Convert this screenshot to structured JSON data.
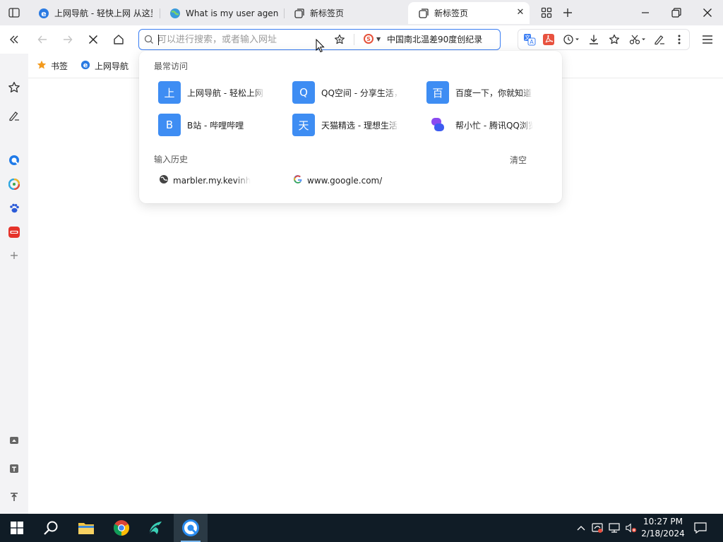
{
  "tabs": [
    {
      "title": "上网导航 - 轻快上网 从这里开始",
      "icon": "ie-e-icon",
      "active": false
    },
    {
      "title": "What is my user agent?",
      "icon": "globe-icon",
      "active": false
    },
    {
      "title": "新标签页",
      "icon": "tab-page-icon",
      "active": false
    },
    {
      "title": "新标签页",
      "icon": "tab-page-icon",
      "active": true
    }
  ],
  "address_bar": {
    "value": "",
    "placeholder": "可以进行搜索，或者输入网址",
    "hot_search": "中国南北温差90度创纪录"
  },
  "bookmarks": [
    {
      "label": "书签",
      "icon": "star-folder-icon"
    },
    {
      "label": "上网导航",
      "icon": "ie-e-icon"
    }
  ],
  "dropdown": {
    "frequent_title": "最常访问",
    "frequent_sites": [
      {
        "initial": "上",
        "name": "上网导航 - 轻松上网，从这里开始"
      },
      {
        "initial": "Q",
        "name": "QQ空间 - 分享生活，留住感动"
      },
      {
        "initial": "百",
        "name": "百度一下，你就知道"
      },
      {
        "initial": "B",
        "name": "B站 - 哔哩哔哩"
      },
      {
        "initial": "天",
        "name": "天猫精选 - 理想生活上天猫"
      },
      {
        "initial": "",
        "name": "帮小忙 - 腾讯QQ浏览器"
      }
    ],
    "history_title": "输入历史",
    "clear_label": "清空",
    "history": [
      {
        "text": "marbler.my.kevinhenry",
        "icon": "globe-icon"
      },
      {
        "text": "www.google.com/",
        "icon": "google-g-icon"
      }
    ]
  },
  "clock": {
    "time": "10:27 PM",
    "date": "2/18/2024"
  },
  "colors": {
    "accent": "#3b7ef3",
    "tile": "#3e8df3",
    "taskbar": "#101c26"
  }
}
